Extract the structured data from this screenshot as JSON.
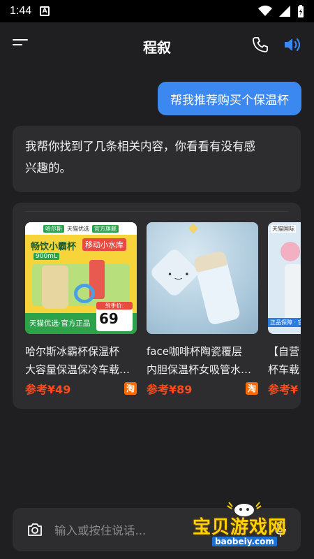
{
  "status_bar": {
    "time": "1:44",
    "notification_letter": "A"
  },
  "header": {
    "title": "程叙",
    "menu_icon": "menu-icon",
    "phone_icon": "phone-icon",
    "speaker_icon": "speaker-icon"
  },
  "chat": {
    "user_message": "帮我推荐购买个保温杯",
    "bot_message_line1": "我帮你找到了几条相关内容，你看看有没有感",
    "bot_message_line2": "兴趣的。"
  },
  "products": [
    {
      "title_line1": "哈尔斯冰霸杯保温杯",
      "title_line2": "大容量保温保冷车载…",
      "price": "参考¥49",
      "badge": "淘",
      "img_banner": "畅饮小霸杯",
      "img_banner2": "移动小水库",
      "img_tag": "天猫优选·官方正品",
      "img_price_label": "到手价:",
      "img_price": "69",
      "img_header_brand": "哈尔斯",
      "img_header_store": "天猫优选",
      "img_header_badge": "官方旗舰",
      "img_volume": "900mL"
    },
    {
      "title_line1": "face咖啡杯陶瓷覆层",
      "title_line2": "内胆保温杯女吸管水…",
      "price": "参考¥89",
      "badge": "淘"
    },
    {
      "title_line1": "【自营",
      "title_line2": "杯车载",
      "price": "参考¥",
      "badge": "",
      "img_header_store": "天猫国际",
      "img_tag": "正品保障 · 官"
    }
  ],
  "input": {
    "placeholder": "输入或按住说话..."
  },
  "watermark": {
    "title": "宝贝游戏网",
    "url": "baobeiy.com"
  },
  "colors": {
    "background": "#1f1f21",
    "bubble_user": "#3b88f0",
    "bubble_bot": "#2d2d30",
    "price": "#ff4a1c",
    "accent_speaker": "#3b88f0"
  }
}
